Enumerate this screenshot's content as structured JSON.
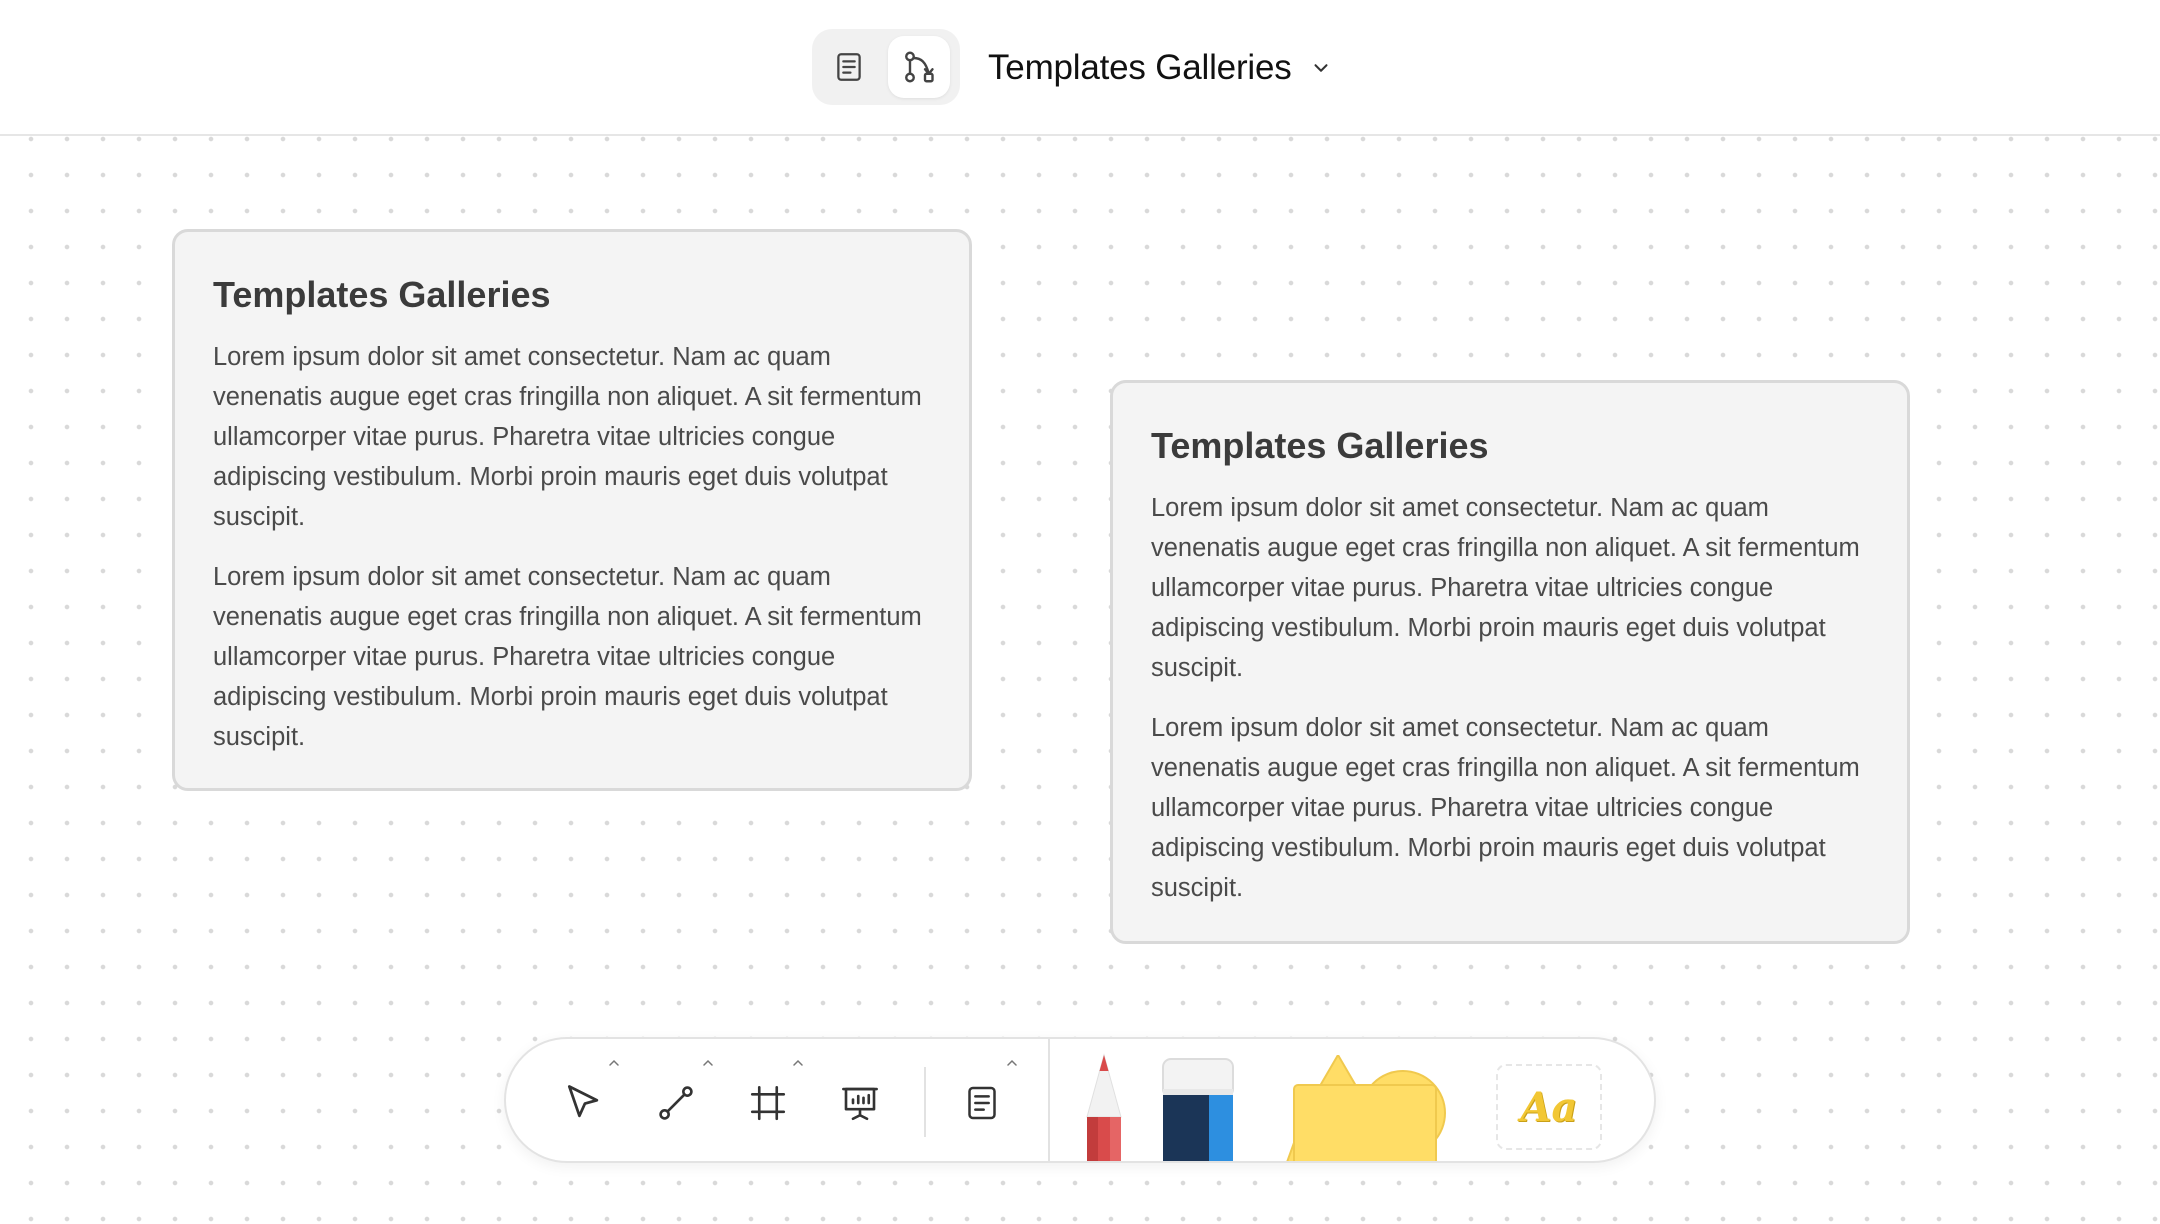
{
  "header": {
    "title": "Templates Galleries",
    "mode_icons": [
      "document-icon",
      "flow-icon"
    ],
    "active_mode": "flow"
  },
  "cards": [
    {
      "title": "Templates Galleries",
      "paragraphs": [
        "Lorem ipsum dolor sit amet consectetur. Nam ac quam venenatis augue eget cras fringilla non aliquet. A sit fermentum ullamcorper vitae purus. Pharetra vitae ultricies congue adipiscing vestibulum. Morbi proin mauris eget duis volutpat suscipit.",
        "Lorem ipsum dolor sit amet consectetur. Nam ac quam venenatis augue eget cras fringilla non aliquet. A sit fermentum ullamcorper vitae purus. Pharetra vitae ultricies congue adipiscing vestibulum. Morbi proin mauris eget duis volutpat suscipit."
      ]
    },
    {
      "title": "Templates Galleries",
      "paragraphs": [
        "Lorem ipsum dolor sit amet consectetur. Nam ac quam venenatis augue eget cras fringilla non aliquet. A sit fermentum ullamcorper vitae purus. Pharetra vitae ultricies congue adipiscing vestibulum. Morbi proin mauris eget duis volutpat suscipit.",
        "Lorem ipsum dolor sit amet consectetur. Nam ac quam venenatis augue eget cras fringilla non aliquet. A sit fermentum ullamcorper vitae purus. Pharetra vitae ultricies congue adipiscing vestibulum. Morbi proin mauris eget duis volutpat suscipit."
      ]
    }
  ],
  "toolbar": {
    "tools": [
      "cursor-icon",
      "connector-icon",
      "frame-icon",
      "presentation-icon",
      "note-icon"
    ],
    "stickers": [
      "pencil",
      "eraser",
      "shapes"
    ],
    "text_tool_label": "Aa"
  },
  "colors": {
    "card_bg": "#f4f4f4",
    "card_border": "#d9d9d9",
    "pencil_red": "#d94b4b",
    "eraser_navy": "#1b3557",
    "eraser_blue": "#2d8fe0",
    "shape_yellow": "#ffdd66",
    "text_yellow": "#f2c734"
  }
}
